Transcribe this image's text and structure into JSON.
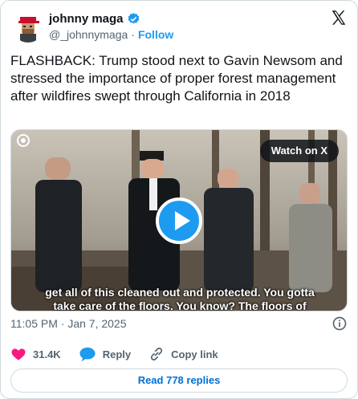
{
  "author": {
    "display_name": "johnny maga",
    "handle": "@_johnnymaga",
    "separator": "·",
    "follow_label": "Follow"
  },
  "tweet": {
    "text": "FLASHBACK: Trump stood next to Gavin Newsom and stressed the importance of proper forest management after wildfires swept through California in 2018",
    "timestamp": "11:05 PM · Jan 7, 2025"
  },
  "media": {
    "watch_label": "Watch on X",
    "caption_line1": "get all of this cleaned out and protected. You gotta",
    "caption_line2": "take care of the floors. You know? The floors of"
  },
  "actions": {
    "like_count": "31.4K",
    "reply_label": "Reply",
    "copy_label": "Copy link"
  },
  "footer": {
    "read_replies_label": "Read 778 replies"
  },
  "colors": {
    "accent": "#1d9bf0",
    "like": "#f91880",
    "link": "#006fd6"
  }
}
